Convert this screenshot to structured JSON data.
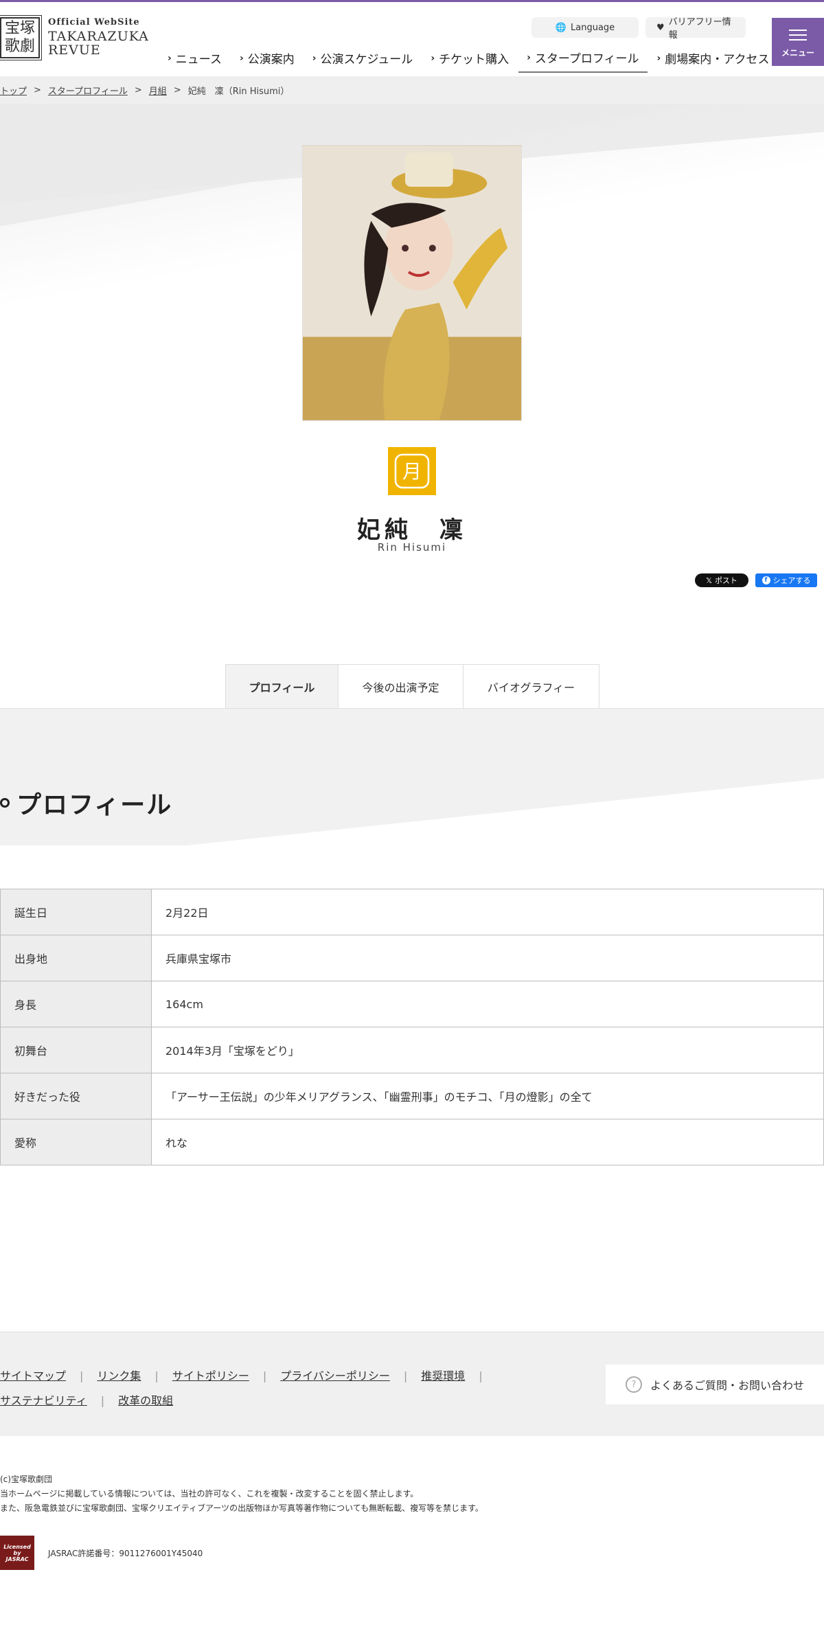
{
  "header": {
    "logo_mark": "宝塚\n歌劇",
    "logo_sub": "Official WebSite",
    "logo_main_1": "TAKARAZUKA",
    "logo_main_2": "REVUE",
    "language_label": "Language",
    "barrier_free_label": "バリアフリー情報",
    "menu_label": "メニュー",
    "nav": [
      {
        "label": "ニュース"
      },
      {
        "label": "公演案内"
      },
      {
        "label": "公演スケジュール"
      },
      {
        "label": "チケット購入"
      },
      {
        "label": "スタープロフィール"
      },
      {
        "label": "劇場案内・アクセス"
      }
    ],
    "active_nav": "スタープロフィール"
  },
  "breadcrumb": {
    "top": "トップ",
    "profile": "スタープロフィール",
    "troupe": "月組",
    "current": "妃純　凜（Rin Hisumi）"
  },
  "star": {
    "name": "妃純　凜",
    "roman": "Rin Hisumi",
    "troupe_badge_glyph": "月",
    "badge_color": "#f0b400"
  },
  "share": {
    "x_label": "ポスト",
    "fb_label": "シェアする"
  },
  "tabs": [
    {
      "label": "プロフィール",
      "active": true
    },
    {
      "label": "今後の出演予定",
      "active": false
    },
    {
      "label": "バイオグラフィー",
      "active": false
    }
  ],
  "profile": {
    "title": "プロフィール",
    "rows": [
      {
        "label": "誕生日",
        "value": "2月22日"
      },
      {
        "label": "出身地",
        "value": "兵庫県宝塚市"
      },
      {
        "label": "身長",
        "value": "164cm"
      },
      {
        "label": "初舞台",
        "value": "2014年3月「宝塚をどり」"
      },
      {
        "label": "好きだった役",
        "value": "「アーサー王伝説」の少年メリアグランス、「幽霊刑事」のモチコ、「月の燈影」の全て"
      },
      {
        "label": "愛称",
        "value": "れな"
      }
    ]
  },
  "footer": {
    "links_row1": [
      "サイトマップ",
      "リンク集",
      "サイトポリシー",
      "プライバシーポリシー",
      "推奨環境"
    ],
    "links_row2": [
      "サステナビリティ",
      "改革の取組"
    ],
    "contact_label": "よくあるご質問・お問い合わせ",
    "copyright": "(c)宝塚歌劇団",
    "notice_1": "当ホームページに掲載している情報については、当社の許可なく、これを複製・改変することを固く禁止します。",
    "notice_2": "また、阪急電鉄並びに宝塚歌劇団、宝塚クリエイティブアーツの出版物ほか写真等著作物についても無断転載、複写等を禁じます。",
    "jasrac_logo_text": "Licensed by JASRAC",
    "jasrac_number": "JASRAC許諾番号：9011276001Y45040"
  },
  "colors": {
    "brand_purple": "#7b5ba8",
    "fb_blue": "#1877f2"
  }
}
